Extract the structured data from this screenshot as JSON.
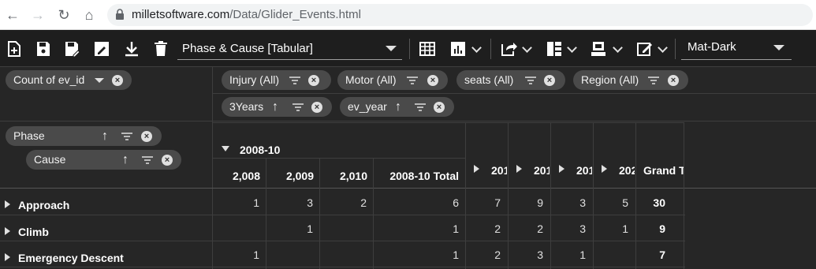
{
  "browser": {
    "url_domain": "milletsoftware.com",
    "url_path": "/Data/Glider_Events.html"
  },
  "toolbar": {
    "report_name": "Phase & Cause [Tabular]",
    "theme": "Mat-Dark"
  },
  "value_field": "Count of ev_id",
  "filters_row1": [
    "Injury (All)",
    "Motor (All)",
    "seats (All)",
    "Region (All)"
  ],
  "filters_row2": [
    "3Years",
    "ev_year"
  ],
  "row_fields": [
    "Phase",
    "Cause"
  ],
  "columns": {
    "group_label": "2008-10",
    "sub_headers": [
      "2,008",
      "2,009",
      "2,010",
      "2008-10 Total"
    ],
    "collapsed_groups": [
      "201",
      "201",
      "201",
      "202"
    ],
    "grand_total": "Grand To"
  },
  "rows": [
    {
      "label": "Approach",
      "values": [
        "1",
        "3",
        "2",
        "6",
        "7",
        "9",
        "3",
        "5",
        "30"
      ]
    },
    {
      "label": "Climb",
      "values": [
        "",
        "1",
        "",
        "1",
        "2",
        "2",
        "3",
        "1",
        "9"
      ]
    },
    {
      "label": "Emergency Descent",
      "values": [
        "1",
        "",
        "",
        "1",
        "2",
        "3",
        "1",
        "",
        "7"
      ]
    }
  ],
  "colors": {
    "background": "#262626",
    "toolbar": "#1e1e1e",
    "pill": "#4a4a4a"
  }
}
